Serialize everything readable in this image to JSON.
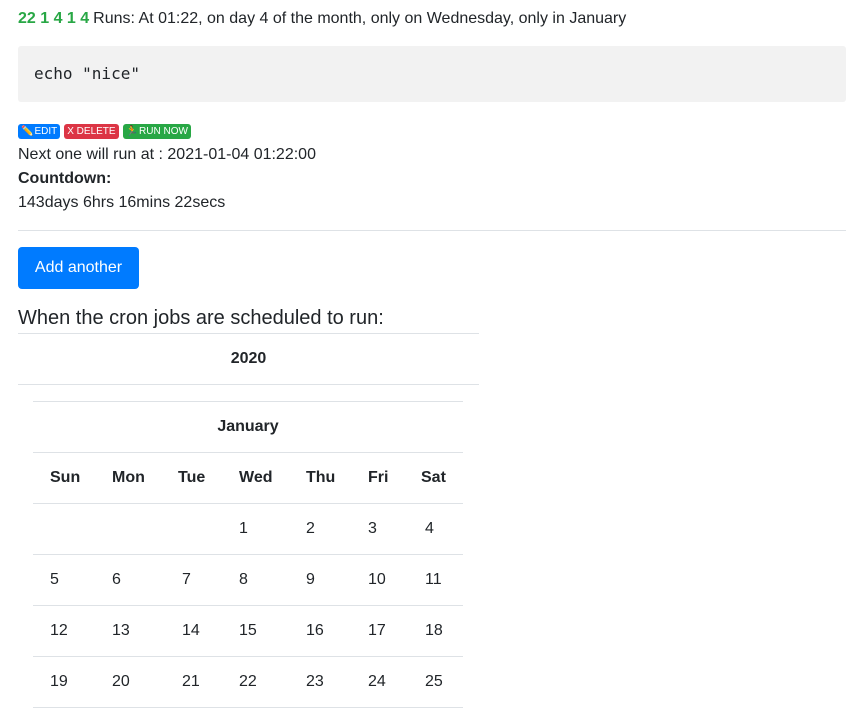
{
  "job": {
    "cron_expression": "22 1 4 1 4",
    "description": "Runs: At 01:22, on day 4 of the month, only on Wednesday, only in January",
    "command": "echo \"nice\"",
    "actions": {
      "edit_label": "EDIT",
      "delete_label": "X DELETE",
      "run_label": "RUN NOW"
    },
    "next_run": "Next one will run at : 2021-01-04 01:22:00",
    "countdown_label": "Countdown:",
    "countdown_value": "143days 6hrs 16mins 22secs"
  },
  "add_button_label": "Add another",
  "schedule_heading": "When the cron jobs are scheduled to run:",
  "calendar": {
    "year": "2020",
    "month": "January",
    "weekdays": [
      "Sun",
      "Mon",
      "Tue",
      "Wed",
      "Thu",
      "Fri",
      "Sat"
    ],
    "weeks": [
      [
        "",
        "",
        "",
        "1",
        "2",
        "3",
        "4"
      ],
      [
        "5",
        "6",
        "7",
        "8",
        "9",
        "10",
        "11"
      ],
      [
        "12",
        "13",
        "14",
        "15",
        "16",
        "17",
        "18"
      ],
      [
        "19",
        "20",
        "21",
        "22",
        "23",
        "24",
        "25"
      ]
    ]
  },
  "colors": {
    "primary": "#007bff",
    "danger": "#dc3545",
    "success": "#28a745"
  },
  "icons": {
    "edit": "pencil-icon",
    "run": "runner-icon"
  }
}
